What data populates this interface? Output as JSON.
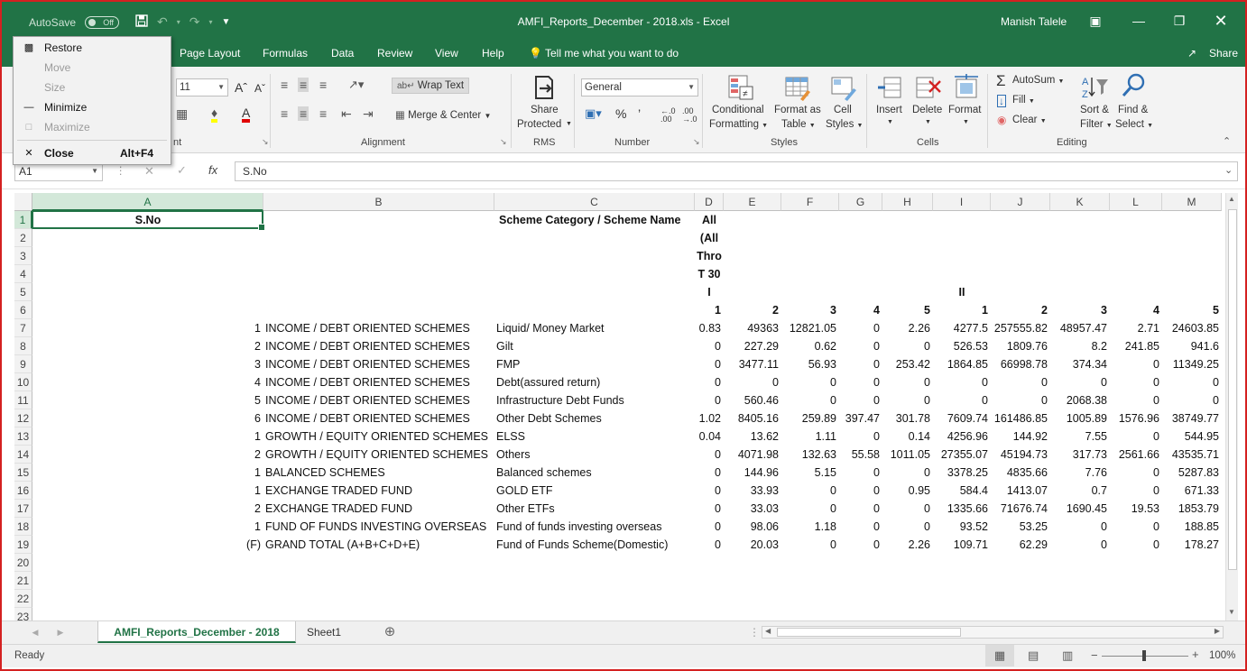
{
  "window": {
    "title": "AMFI_Reports_December - 2018.xls  -  Excel",
    "autosave_label": "AutoSave",
    "autosave_state": "Off",
    "user": "Manish Talele",
    "share": "Share"
  },
  "ribbon_tabs": [
    "Page Layout",
    "Formulas",
    "Data",
    "Review",
    "View",
    "Help",
    "Tell me what you want to do"
  ],
  "ribbon": {
    "font_size": "11",
    "font_group_label": "nt",
    "wrap_text": "Wrap Text",
    "merge_center": "Merge & Center",
    "alignment_label": "Alignment",
    "share_protected_1": "Share",
    "share_protected_2": "Protected",
    "rms_label": "RMS",
    "number_format": "General",
    "number_label": "Number",
    "cond_format_1": "Conditional",
    "cond_format_2": "Formatting",
    "format_table_1": "Format as",
    "format_table_2": "Table",
    "cell_styles_1": "Cell",
    "cell_styles_2": "Styles",
    "styles_label": "Styles",
    "insert": "Insert",
    "delete": "Delete",
    "format": "Format",
    "cells_label": "Cells",
    "autosum": "AutoSum",
    "fill": "Fill",
    "clear": "Clear",
    "sort_filter_1": "Sort &",
    "sort_filter_2": "Filter",
    "find_select_1": "Find &",
    "find_select_2": "Select",
    "editing_label": "Editing"
  },
  "formula_bar": {
    "name_box": "A1",
    "formula": "S.No"
  },
  "columns": [
    "A",
    "B",
    "C",
    "D",
    "E",
    "F",
    "G",
    "H",
    "I",
    "J",
    "K",
    "L",
    "M"
  ],
  "rows": [
    "1",
    "2",
    "3",
    "4",
    "5",
    "6",
    "7",
    "8",
    "9",
    "10",
    "11",
    "12",
    "13",
    "14",
    "15",
    "16",
    "17",
    "18",
    "19",
    "20",
    "21",
    "22",
    "23"
  ],
  "header": {
    "a1": "S.No",
    "c1": "Scheme Category / Scheme Name",
    "d1": "All",
    "d2": "(All",
    "d3": "Thro",
    "d4": "T 30",
    "d5": "I",
    "i5": "II",
    "row6": [
      "1",
      "2",
      "3",
      "4",
      "5",
      "1",
      "2",
      "3",
      "4",
      "5"
    ]
  },
  "data_rows": [
    {
      "num": "1",
      "cat": "INCOME / DEBT ORIENTED SCHEMES",
      "scheme": "Liquid/ Money Market",
      "vals": [
        "0.83",
        "49363",
        "12821.05",
        "0",
        "2.26",
        "4277.5",
        "257555.82",
        "48957.47",
        "2.71",
        "24603.85"
      ]
    },
    {
      "num": "2",
      "cat": "INCOME / DEBT ORIENTED SCHEMES",
      "scheme": "Gilt",
      "vals": [
        "0",
        "227.29",
        "0.62",
        "0",
        "0",
        "526.53",
        "1809.76",
        "8.2",
        "241.85",
        "941.6"
      ]
    },
    {
      "num": "3",
      "cat": "INCOME / DEBT ORIENTED SCHEMES",
      "scheme": "FMP",
      "vals": [
        "0",
        "3477.11",
        "56.93",
        "0",
        "253.42",
        "1864.85",
        "66998.78",
        "374.34",
        "0",
        "11349.25"
      ]
    },
    {
      "num": "4",
      "cat": "INCOME / DEBT ORIENTED SCHEMES",
      "scheme": "Debt(assured return)",
      "vals": [
        "0",
        "0",
        "0",
        "0",
        "0",
        "0",
        "0",
        "0",
        "0",
        "0"
      ]
    },
    {
      "num": "5",
      "cat": "INCOME / DEBT ORIENTED SCHEMES",
      "scheme": "Infrastructure Debt Funds",
      "vals": [
        "0",
        "560.46",
        "0",
        "0",
        "0",
        "0",
        "0",
        "2068.38",
        "0",
        "0"
      ]
    },
    {
      "num": "6",
      "cat": "INCOME / DEBT ORIENTED SCHEMES",
      "scheme": "Other Debt Schemes",
      "vals": [
        "1.02",
        "8405.16",
        "259.89",
        "397.47",
        "301.78",
        "7609.74",
        "161486.85",
        "1005.89",
        "1576.96",
        "38749.77"
      ]
    },
    {
      "num": "1",
      "cat": "GROWTH / EQUITY ORIENTED SCHEMES",
      "scheme": "ELSS",
      "vals": [
        "0.04",
        "13.62",
        "1.11",
        "0",
        "0.14",
        "4256.96",
        "144.92",
        "7.55",
        "0",
        "544.95"
      ]
    },
    {
      "num": "2",
      "cat": "GROWTH / EQUITY ORIENTED SCHEMES",
      "scheme": "Others",
      "vals": [
        "0",
        "4071.98",
        "132.63",
        "55.58",
        "1011.05",
        "27355.07",
        "45194.73",
        "317.73",
        "2561.66",
        "43535.71"
      ]
    },
    {
      "num": "1",
      "cat": "BALANCED SCHEMES",
      "scheme": "Balanced schemes",
      "vals": [
        "0",
        "144.96",
        "5.15",
        "0",
        "0",
        "3378.25",
        "4835.66",
        "7.76",
        "0",
        "5287.83"
      ]
    },
    {
      "num": "1",
      "cat": "EXCHANGE TRADED FUND",
      "scheme": "GOLD ETF",
      "vals": [
        "0",
        "33.93",
        "0",
        "0",
        "0.95",
        "584.4",
        "1413.07",
        "0.7",
        "0",
        "671.33"
      ]
    },
    {
      "num": "2",
      "cat": "EXCHANGE TRADED FUND",
      "scheme": "Other ETFs",
      "vals": [
        "0",
        "33.03",
        "0",
        "0",
        "0",
        "1335.66",
        "71676.74",
        "1690.45",
        "19.53",
        "1853.79"
      ]
    },
    {
      "num": "1",
      "cat": "FUND OF FUNDS INVESTING OVERSEAS",
      "scheme": "Fund of funds investing overseas",
      "vals": [
        "0",
        "98.06",
        "1.18",
        "0",
        "0",
        "93.52",
        "53.25",
        "0",
        "0",
        "188.85"
      ]
    },
    {
      "num": "(F)",
      "cat": "GRAND TOTAL (A+B+C+D+E)",
      "scheme": "Fund of Funds Scheme(Domestic)",
      "vals": [
        "0",
        "20.03",
        "0",
        "0",
        "2.26",
        "109.71",
        "62.29",
        "0",
        "0",
        "178.27"
      ]
    }
  ],
  "sheets": {
    "active": "AMFI_Reports_December - 2018",
    "other": "Sheet1"
  },
  "status": {
    "ready": "Ready",
    "zoom": "100%"
  },
  "system_menu": [
    {
      "label": "Restore",
      "accel": "",
      "disabled": false
    },
    {
      "label": "Move",
      "accel": "",
      "disabled": true
    },
    {
      "label": "Size",
      "accel": "",
      "disabled": true
    },
    {
      "label": "Minimize",
      "accel": "",
      "disabled": false
    },
    {
      "label": "Maximize",
      "accel": "",
      "disabled": true
    },
    {
      "label": "Close",
      "accel": "Alt+F4",
      "disabled": false
    }
  ],
  "colors": {
    "excel_green": "#217346",
    "frame_red": "#d42121"
  }
}
